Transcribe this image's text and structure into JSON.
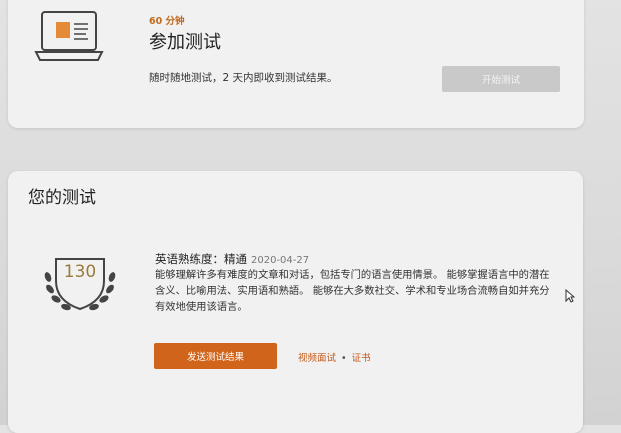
{
  "take_test": {
    "duration": "60 分钟",
    "title": "参加测试",
    "description": "随时随地测试，2 天内即收到测试结果。",
    "start_button": "开始测试"
  },
  "results": {
    "title": "您的测试",
    "score": "130",
    "level_label": "英语熟练度：精通",
    "date": "2020-04-27",
    "description": "能够理解许多有难度的文章和对话，包括专门的语言使用情景。 能够掌握语言中的潜在含义、比喻用法、实用语和熟語。 能够在大多数社交、学术和专业场合流畅自如并充分有效地使用该语言。",
    "send_button": "发送测试结果",
    "links": {
      "video": "视频面试",
      "certificate": "证书"
    }
  },
  "colors": {
    "accent_orange": "#d0641b",
    "link_orange": "#c5591a",
    "badge_gold": "#9a7b3c",
    "disabled_button": "#c9c9c9"
  },
  "icons": {
    "laptop": "laptop-test-icon",
    "badge": "laurel-badge-icon",
    "cursor": "mouse-cursor-icon"
  }
}
